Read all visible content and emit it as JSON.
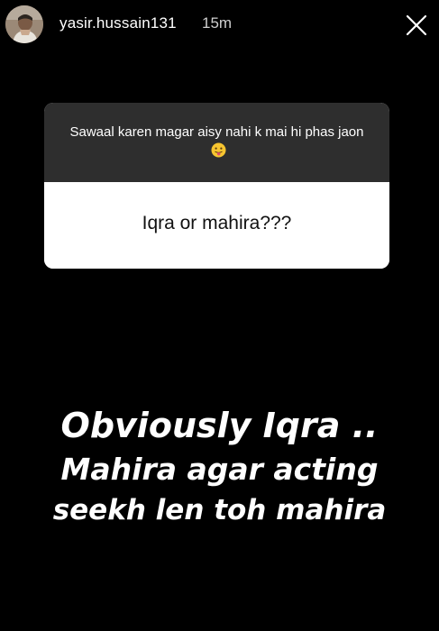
{
  "header": {
    "username": "yasir.hussain131",
    "timestamp": "15m",
    "avatar_icon": "user-avatar-photo",
    "close_icon": "close-x-icon"
  },
  "question_sticker": {
    "prompt": "Sawaal karen magar aisy nahi k mai hi phas jaon",
    "prompt_emoji": "tongue-out-emoji",
    "answer": "Iqra or mahira???",
    "prompt_background": "#2e2e2e",
    "answer_background": "#ffffff"
  },
  "reply": {
    "line1": "Obviously Iqra ..",
    "line2": "Mahira agar acting",
    "line3": "seekh len toh mahira"
  },
  "colors": {
    "background": "#000000",
    "text": "#ffffff"
  }
}
